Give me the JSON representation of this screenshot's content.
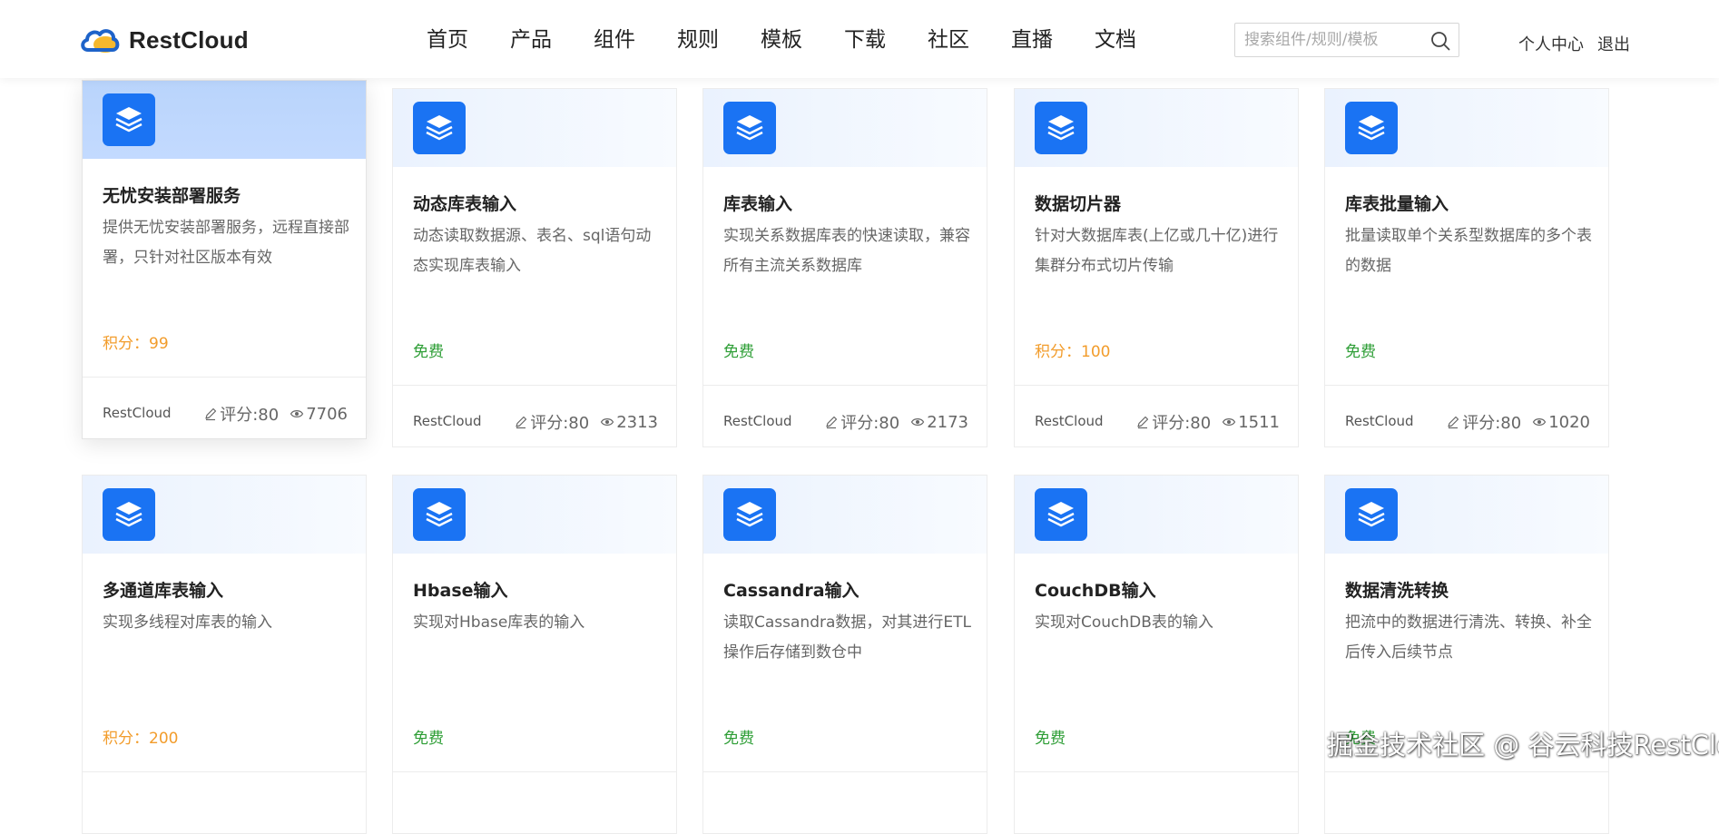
{
  "header": {
    "logo_text": "RestCloud",
    "nav": [
      "首页",
      "产品",
      "组件",
      "规则",
      "模板",
      "下载",
      "社区",
      "直播",
      "文档"
    ],
    "search_placeholder": "搜索组件/规则/模板",
    "user_center": "个人中心",
    "logout": "退出"
  },
  "cards": [
    {
      "title": "无忧安装部署服务",
      "desc": "提供无忧安装部署服务，远程直接部署，只针对社区版本有效",
      "price": "积分：99",
      "price_type": "points",
      "author": "RestCloud",
      "rating": "评分:80",
      "views": "7706"
    },
    {
      "title": "动态库表输入",
      "desc": "动态读取数据源、表名、sql语句动态实现库表输入",
      "price": "免费",
      "price_type": "free",
      "author": "RestCloud",
      "rating": "评分:80",
      "views": "2313"
    },
    {
      "title": "库表输入",
      "desc": "实现关系数据库表的快速读取，兼容所有主流关系数据库",
      "price": "免费",
      "price_type": "free",
      "author": "RestCloud",
      "rating": "评分:80",
      "views": "2173"
    },
    {
      "title": "数据切片器",
      "desc": "针对大数据库表(上亿或几十亿)进行集群分布式切片传输",
      "price": "积分：100",
      "price_type": "points",
      "author": "RestCloud",
      "rating": "评分:80",
      "views": "1511"
    },
    {
      "title": "库表批量输入",
      "desc": "批量读取单个关系型数据库的多个表的数据",
      "price": "免费",
      "price_type": "free",
      "author": "RestCloud",
      "rating": "评分:80",
      "views": "1020"
    },
    {
      "title": "多通道库表输入",
      "desc": "实现多线程对库表的输入",
      "price": "积分：200",
      "price_type": "points"
    },
    {
      "title": "Hbase输入",
      "desc": "实现对Hbase库表的输入",
      "price": "免费",
      "price_type": "free"
    },
    {
      "title": "Cassandra输入",
      "desc": "读取Cassandra数据，对其进行ETL操作后存储到数仓中",
      "price": "免费",
      "price_type": "free"
    },
    {
      "title": "CouchDB输入",
      "desc": "实现对CouchDB表的输入",
      "price": "免费",
      "price_type": "free"
    },
    {
      "title": "数据清洗转换",
      "desc": "把流中的数据进行清洗、转换、补全后传入后续节点",
      "price": "免费",
      "price_type": "free"
    }
  ],
  "watermark": "掘金技术社区 @ 谷云科技RestCloud",
  "colors": {
    "accent": "#1a73f3",
    "free": "#2e9e36",
    "points": "#f29c2b",
    "hover_banner": "#c3daff"
  },
  "icons": {
    "logo": "cloud-logo-icon",
    "card": "layers-icon",
    "search": "search-icon",
    "rating": "pencil-icon",
    "views": "eye-icon"
  }
}
